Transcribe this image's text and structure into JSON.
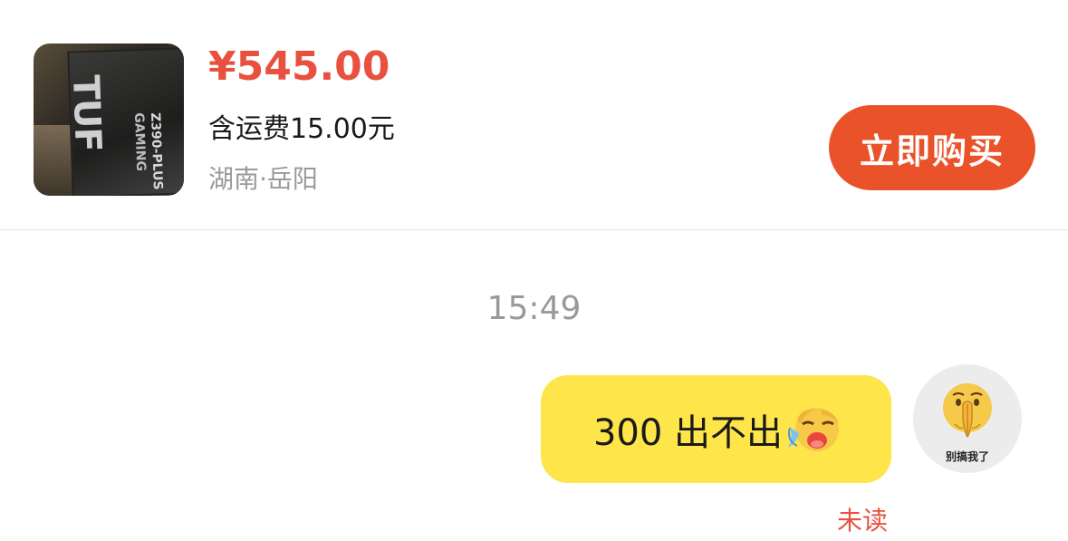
{
  "product": {
    "image_icon": "motherboard-box-photo",
    "price": "¥545.00",
    "shipping": "含运费15.00元",
    "location": "湖南·岳阳",
    "buy_label": "立即购买",
    "thumb_text": {
      "brand": "TUF",
      "model": "Z390-PLUS",
      "line": "GAMING"
    }
  },
  "chat": {
    "timestamp": "15:49",
    "messages": [
      {
        "sender": "me",
        "text": "300 出不出",
        "emoji": "crying-face-emoji",
        "status": "未读"
      }
    ],
    "avatar": {
      "icon": "praying-hands-emoji",
      "caption": "别搞我了"
    }
  },
  "colors": {
    "price": "#e8513f",
    "buy_button": "#ea5229",
    "bubble": "#fde54a",
    "unread": "#e8513f",
    "timestamp": "#999999"
  }
}
